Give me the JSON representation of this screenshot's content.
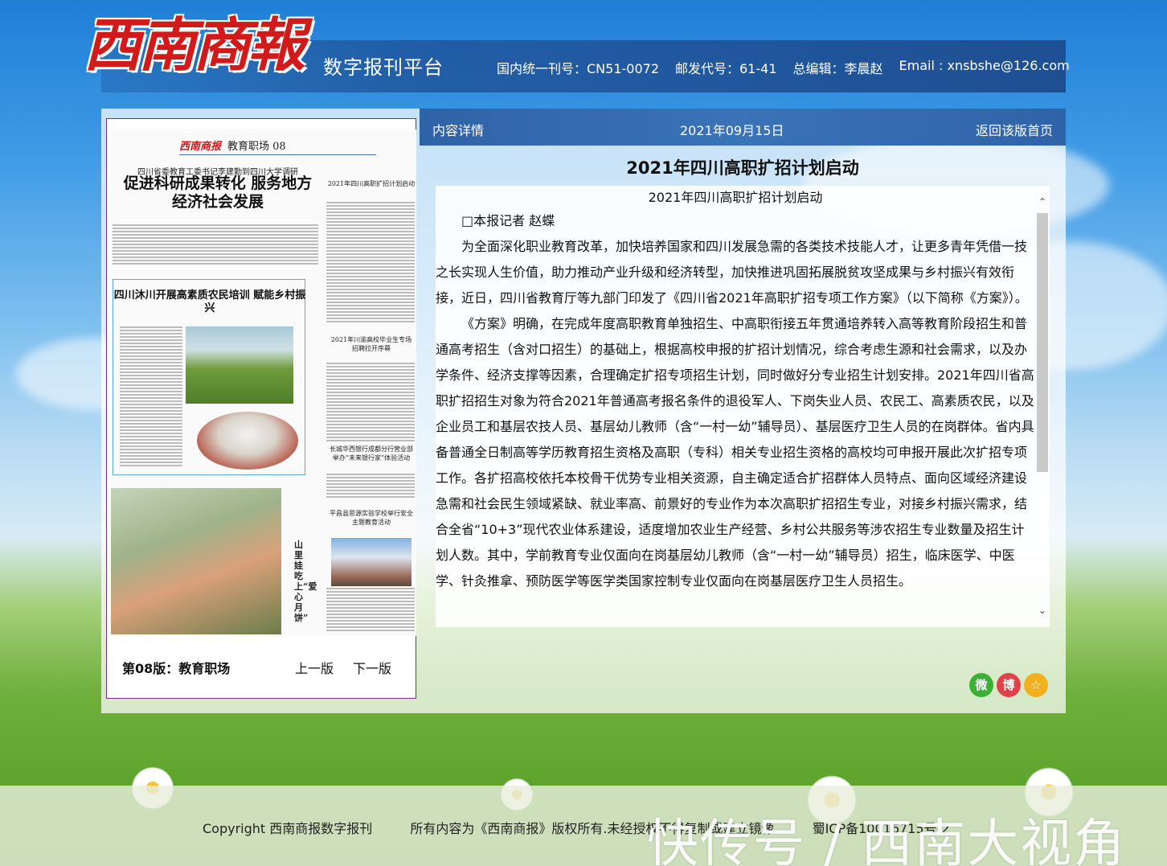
{
  "header": {
    "logo_text": "西南商報",
    "platform": "数字报刊平台",
    "issn": "国内统一刊号：CN51-0072",
    "postal": "邮发代号：61-41",
    "editor": "总编辑：李晨赵",
    "email": "Email : xnsbshe@126.com"
  },
  "paper": {
    "masthead_logo": "西南商报",
    "section_header": "教育职场 08",
    "headline_small": "四川省委教育工委书记李建勤到四川大学调研",
    "headline_main": "促进科研成果转化 服务地方经济社会发展",
    "side_headline": "2021年四川高职扩招计划启动",
    "box_title": "四川沐川开展高素质农民培训 赋能乡村振兴",
    "mid_headline_1": "2021年川渝高校毕业生专场招聘拉开序幕",
    "mid_headline_2": "长城华西银行成都分行营业部举办“未来银行家”体验活动",
    "mid_headline_3": "平昌县思源实验学校举行安全主题教育活动",
    "vertical_caption": "山里娃吃上“爱心月饼”",
    "edition_label": "第08版：教育职场",
    "prev": "上一版",
    "next": "下一版"
  },
  "article_bar": {
    "left": "内容详情",
    "date": "2021年09月15日",
    "right": "返回该版首页"
  },
  "article": {
    "title": "2021年四川高职扩招计划启动",
    "subtitle": "2021年四川高职扩招计划启动",
    "byline": "□本报记者 赵蝶",
    "p1": "为全面深化职业教育改革，加快培养国家和四川发展急需的各类技术技能人才，让更多青年凭借一技之长实现人生价值，助力推动产业升级和经济转型，加快推进巩固拓展脱贫攻坚成果与乡村振兴有效衔接，近日，四川省教育厅等九部门印发了《四川省2021年高职扩招专项工作方案》（以下简称《方案》）。",
    "p2": "《方案》明确，在完成年度高职教育单独招生、中高职衔接五年贯通培养转入高等教育阶段招生和普通高考招生（含对口招生）的基础上，根据高校申报的扩招计划情况，综合考虑生源和社会需求，以及办学条件、经济支撑等因素，合理确定扩招专项招生计划，同时做好分专业招生计划安排。2021年四川省高职扩招招生对象为符合2021年普通高考报名条件的退役军人、下岗失业人员、农民工、高素质农民，以及企业员工和基层农技人员、基层幼儿教师（含“一村一幼”辅导员）、基层医疗卫生人员的在岗群体。省内具备普通全日制高等学历教育招生资格及高职（专科）相关专业招生资格的高校均可申报开展此次扩招专项工作。各扩招高校依托本校骨干优势专业相关资源，自主确定适合扩招群体人员特点、面向区域经济建设急需和社会民生领域紧缺、就业率高、前景好的专业作为本次高职扩招招生专业，对接乡村振兴需求，结合全省“10+3”现代农业体系建设，适度增加农业生产经营、乡村公共服务等涉农招生专业数量及招生计划人数。其中，学前教育专业仅面向在岗基层幼儿教师（含“一村一幼”辅导员）招生，临床医学、中医学、针灸推拿、预防医学等医学类国家控制专业仅面向在岗基层医疗卫生人员招生。"
  },
  "share": {
    "wechat": "微",
    "weibo": "博",
    "favorite": "☆"
  },
  "footer": {
    "copyright": "Copyright 西南商报数字报刊",
    "rights": "所有内容为《西南商报》版权所有.未经授权不得复制或建立镜像",
    "icp": "蜀ICP备10016715号-2"
  },
  "watermark": "快传号 / 西南大视角"
}
